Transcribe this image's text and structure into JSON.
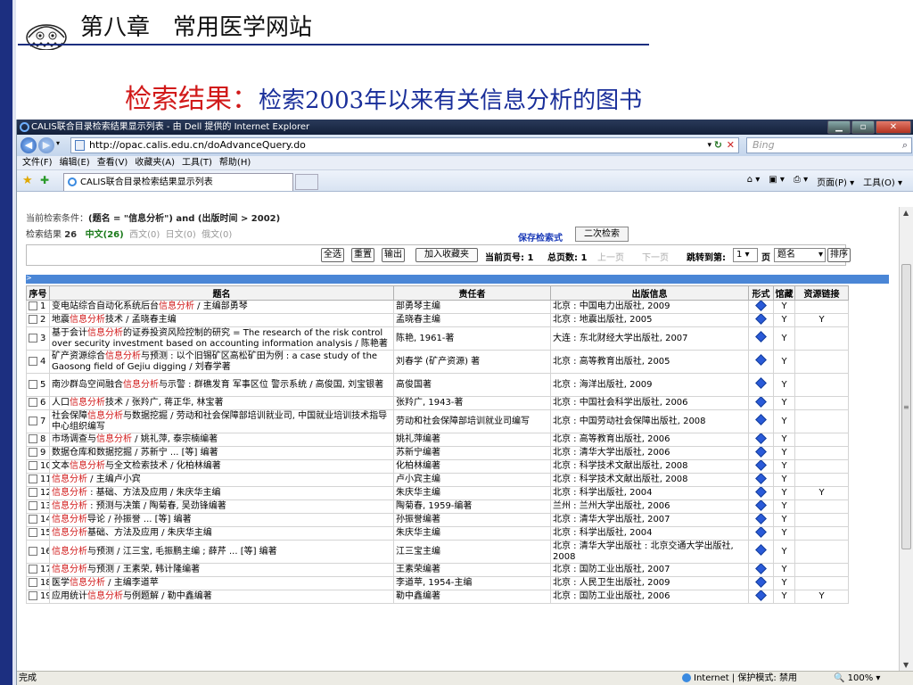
{
  "slide": {
    "title": "第八章　常用医学网站",
    "subtitle_red": "检索结果：",
    "subtitle_blue": "检索2003年以来有关信息分析的图书"
  },
  "browser": {
    "window_title": "CALIS联合目录检索结果显示列表 - 由 Dell 提供的 Internet Explorer",
    "address": "http://opac.calis.edu.cn/doAdvanceQuery.do",
    "search_placeholder": "Bing",
    "menu": [
      "文件(F)",
      "编辑(E)",
      "查看(V)",
      "收藏夹(A)",
      "工具(T)",
      "帮助(H)"
    ],
    "tab_title": "CALIS联合目录检索结果显示列表",
    "tools": [
      "页面(P) ▾",
      "工具(O) ▾"
    ],
    "status_left": "完成",
    "status_zone": "Internet | 保护模式: 禁用",
    "zoom": "100%"
  },
  "page": {
    "condition_label": "当前检索条件：",
    "condition_value": "(题名 = \"信息分析\") and (出版时间 > 2002)",
    "result_label": "检索结果",
    "result_total": "26",
    "lang_cn": "中文(26)",
    "lang_west": "西文(0)",
    "lang_jp": "日文(0)",
    "lang_ru": "俄文(0)",
    "save_query": "保存检索式",
    "second_search": "二次检索",
    "buttons": {
      "select_all": "全选",
      "reset": "重置",
      "output": "输出",
      "add_fav": "加入收藏夹"
    },
    "current_page": "当前页号: 1",
    "total_pages": "总页数: 1",
    "prev_page": "上一页",
    "next_page": "下一页",
    "jump_to": "跳转到第:",
    "jump_value": "1 ▾",
    "page_unit": "页",
    "sort_field": "题名",
    "sort_button": "排序",
    "headers": [
      "序号",
      "题名",
      "责任者",
      "出版信息",
      "形式",
      "馆藏",
      "资源链接"
    ]
  },
  "rows": [
    {
      "no": "1",
      "pre": "变电站综合自动化系统后台",
      "hl": "信息分析",
      "post": " / 主编部勇琴",
      "author": "部勇琴主编",
      "pub": "北京 : 中国电力出版社, 2009",
      "hold": "Y",
      "link": ""
    },
    {
      "no": "2",
      "pre": "地震",
      "hl": "信息分析",
      "post": "技术 / 孟晓春主编",
      "author": "孟晓春主编",
      "pub": "北京 : 地震出版社, 2005",
      "hold": "Y",
      "link": "Y"
    },
    {
      "no": "3",
      "pre": "基于会计",
      "hl": "信息分析",
      "post": "的证券投资风险控制的研究 = The research of the risk control over security investment based on accounting information analysis / 陈艳著",
      "author": "陈艳, 1961-著",
      "pub": "大连 : 东北财经大学出版社, 2007",
      "hold": "Y",
      "link": ""
    },
    {
      "no": "4",
      "pre": "矿产资源综合",
      "hl": "信息分析",
      "post": "与预测 : 以个旧锡矿区高松矿田为例 : a case study of the Gaosong field of Gejiu digging / 刘春学著",
      "author": "刘春学 (矿产资源) 著",
      "pub": "北京 : 高等教育出版社, 2005",
      "hold": "Y",
      "link": ""
    },
    {
      "no": "5",
      "pre": "南沙群岛空间融合",
      "hl": "信息分析",
      "post": "与示警 : 群礁发育 军事区位 警示系统 / 高俊国, 刘宝银著",
      "author": "高俊国著",
      "pub": "北京 : 海洋出版社, 2009",
      "hold": "Y",
      "link": ""
    },
    {
      "no": "6",
      "pre": "人口",
      "hl": "信息分析",
      "post": "技术 / 张羚广, 蒋正华, 林宝著",
      "author": "张羚广, 1943-著",
      "pub": "北京 : 中国社会科学出版社, 2006",
      "hold": "Y",
      "link": ""
    },
    {
      "no": "7",
      "pre": "社会保障",
      "hl": "信息分析",
      "post": "与数据挖掘 / 劳动和社会保障部培训就业司, 中国就业培训技术指导中心组织编写",
      "author": "劳动和社会保障部培训就业司编写",
      "pub": "北京 : 中国劳动社会保障出版社, 2008",
      "hold": "Y",
      "link": ""
    },
    {
      "no": "8",
      "pre": "市场调查与",
      "hl": "信息分析",
      "post": " / 姚礼萍, 泰宗楠编著",
      "author": "姚礼萍编著",
      "pub": "北京 : 高等教育出版社, 2006",
      "hold": "Y",
      "link": ""
    },
    {
      "no": "9",
      "pre": "数据仓库和数据挖掘 / 苏新宁 ... [等] 编著",
      "hl": "",
      "post": "",
      "author": "苏新宁编著",
      "pub": "北京 : 清华大学出版社, 2006",
      "hold": "Y",
      "link": ""
    },
    {
      "no": "10",
      "pre": "文本",
      "hl": "信息分析",
      "post": "与全文检索技术 / 化柏林编著",
      "author": "化柏林编著",
      "pub": "北京 : 科学技术文献出版社, 2008",
      "hold": "Y",
      "link": ""
    },
    {
      "no": "11",
      "pre": "",
      "hl": "信息分析",
      "post": " / 主编卢小宾",
      "author": "卢小宾主编",
      "pub": "北京 : 科学技术文献出版社, 2008",
      "hold": "Y",
      "link": ""
    },
    {
      "no": "12",
      "pre": "",
      "hl": "信息分析",
      "post": " : 基础、方法及应用 / 朱庆华主编",
      "author": "朱庆华主编",
      "pub": "北京 : 科学出版社, 2004",
      "hold": "Y",
      "link": "Y"
    },
    {
      "no": "13",
      "pre": "",
      "hl": "信息分析",
      "post": " : 预测与决策 / 陶菊春, 吴劲锋编著",
      "author": "陶菊春, 1959-编著",
      "pub": "兰州 : 兰州大学出版社, 2006",
      "hold": "Y",
      "link": ""
    },
    {
      "no": "14",
      "pre": "",
      "hl": "信息分析",
      "post": "导论 / 孙振誉 ... [等] 编著",
      "author": "孙振誉编著",
      "pub": "北京 : 清华大学出版社, 2007",
      "hold": "Y",
      "link": ""
    },
    {
      "no": "15",
      "pre": "",
      "hl": "信息分析",
      "post": "基础、方法及应用 / 朱庆华主编",
      "author": "朱庆华主编",
      "pub": "北京 : 科学出版社, 2004",
      "hold": "Y",
      "link": ""
    },
    {
      "no": "16",
      "pre": "",
      "hl": "信息分析",
      "post": "与预测 / 江三宝, 毛振鹏主编 ; 薛芹 ... [等] 编著",
      "author": "江三宝主编",
      "pub": "北京 : 清华大学出版社 : 北京交通大学出版社, 2008",
      "hold": "Y",
      "link": ""
    },
    {
      "no": "17",
      "pre": "",
      "hl": "信息分析",
      "post": "与预测 / 王素荣, 韩计隆编著",
      "author": "王素荣编著",
      "pub": "北京 : 国防工业出版社, 2007",
      "hold": "Y",
      "link": ""
    },
    {
      "no": "18",
      "pre": "医学",
      "hl": "信息分析",
      "post": " / 主编李道苹",
      "author": "李道苹, 1954-主编",
      "pub": "北京 : 人民卫生出版社, 2009",
      "hold": "Y",
      "link": ""
    },
    {
      "no": "19",
      "pre": "应用统计",
      "hl": "信息分析",
      "post": "与例题解 / 勒中鑫编著",
      "author": "勒中鑫编著",
      "pub": "北京 : 国防工业出版社, 2006",
      "hold": "Y",
      "link": "Y"
    }
  ]
}
